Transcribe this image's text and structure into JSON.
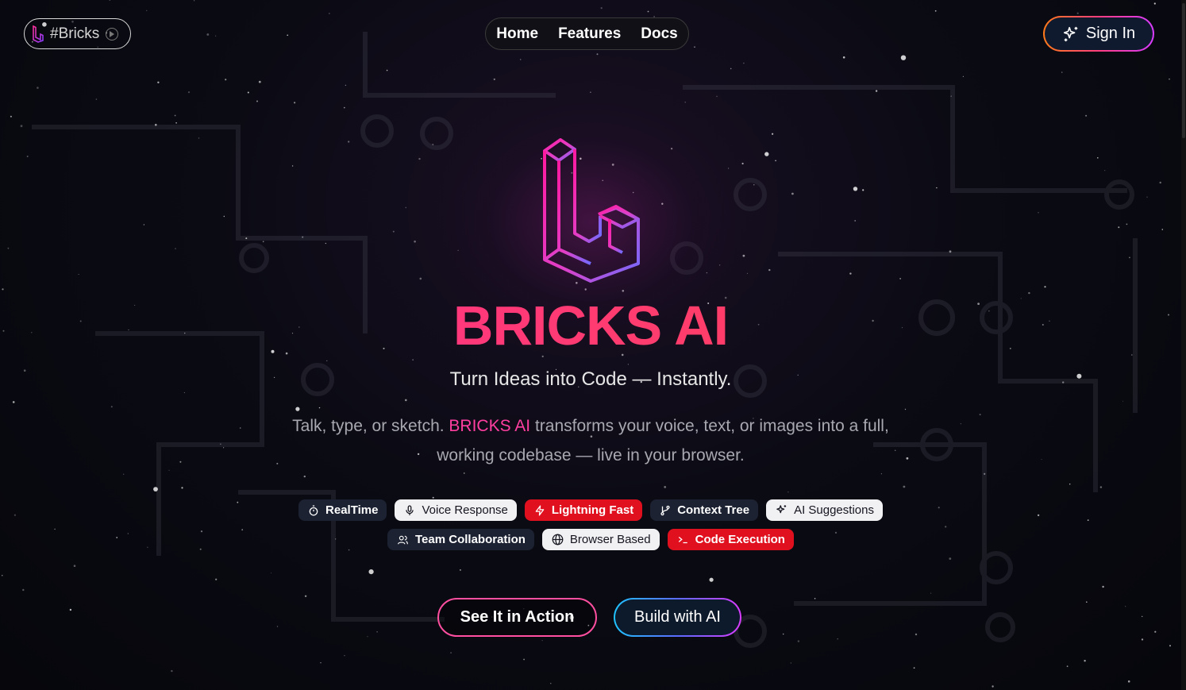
{
  "brand": {
    "label": "#Bricks",
    "logo_icon": "bricks-logo-icon",
    "badge_icon": "play-circle-icon"
  },
  "nav": {
    "items": [
      {
        "label": "Home"
      },
      {
        "label": "Features"
      },
      {
        "label": "Docs"
      }
    ]
  },
  "signin": {
    "label": "Sign In",
    "icon": "sparkles-icon"
  },
  "hero": {
    "title": "BRICKS AI",
    "tagline": "Turn Ideas into Code — Instantly.",
    "desc_before": "Talk, type, or sketch. ",
    "desc_highlight": "BRICKS AI",
    "desc_after": " transforms your voice, text, or images into a full, working codebase — live in your browser."
  },
  "features_row1": [
    {
      "label": "RealTime",
      "icon": "timer-icon",
      "style": "dark"
    },
    {
      "label": "Voice Response",
      "icon": "mic-icon",
      "style": "light"
    },
    {
      "label": "Lightning Fast",
      "icon": "zap-icon",
      "style": "red"
    },
    {
      "label": "Context Tree",
      "icon": "git-branch-icon",
      "style": "dark"
    },
    {
      "label": "AI Suggestions",
      "icon": "sparkles-icon",
      "style": "light"
    }
  ],
  "features_row2": [
    {
      "label": "Team Collaboration",
      "icon": "users-icon",
      "style": "dark"
    },
    {
      "label": "Browser Based",
      "icon": "globe-icon",
      "style": "light"
    },
    {
      "label": "Code Execution",
      "icon": "terminal-icon",
      "style": "red"
    }
  ],
  "cta": {
    "primary": "See It in Action",
    "secondary": "Build with AI"
  },
  "colors": {
    "accent_pink": "#ff2f9a",
    "accent_red": "#e0101f",
    "chip_dark": "#1c2232",
    "background": "#06060c"
  }
}
